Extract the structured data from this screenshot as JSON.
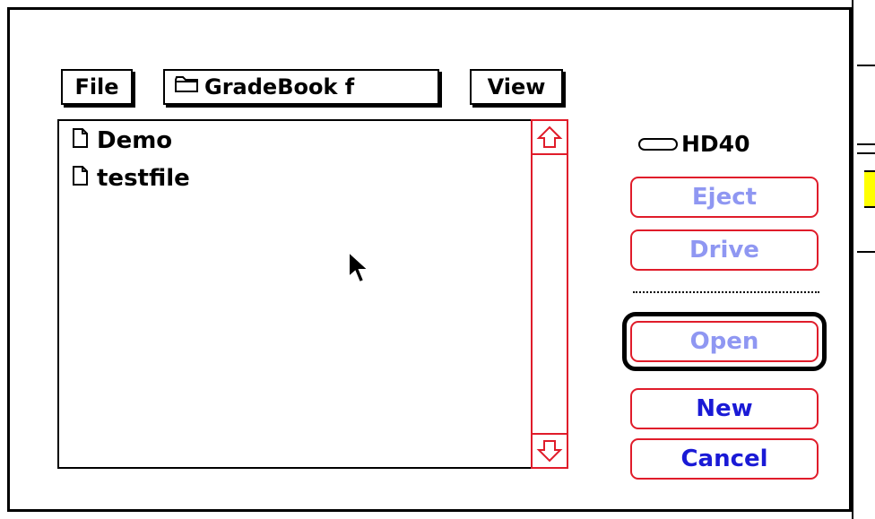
{
  "dialog": {
    "menu": {
      "file_label": "File",
      "view_label": "View"
    },
    "folder_popup": {
      "label": "GradeBook f",
      "icon": "folder-icon"
    },
    "file_list": {
      "items": [
        {
          "name": "Demo",
          "icon": "document-icon"
        },
        {
          "name": "testfile",
          "icon": "document-icon"
        }
      ]
    },
    "disk": {
      "name": "HD40",
      "icon": "hard-disk-icon"
    },
    "buttons": {
      "eject": "Eject",
      "drive": "Drive",
      "open": "Open",
      "new": "New",
      "cancel": "Cancel"
    },
    "colors": {
      "frame_red": "#e01c2a",
      "button_blue": "#1a1ad6",
      "disabled_blue": "#8f97f2"
    }
  }
}
